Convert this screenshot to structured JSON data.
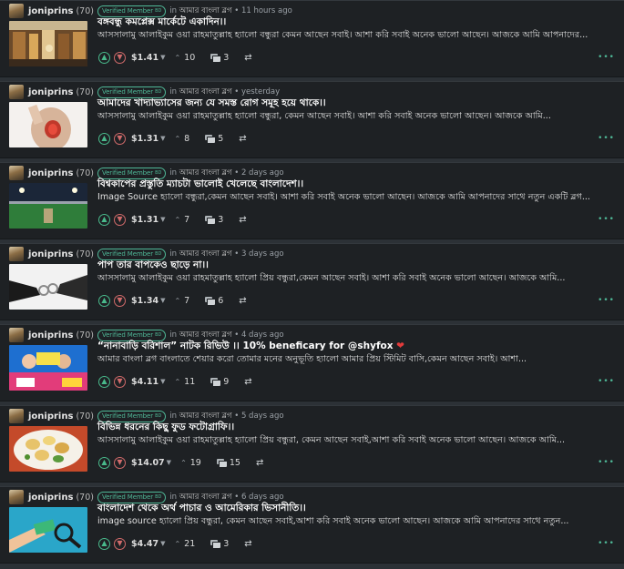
{
  "author": "joniprins",
  "reputation": "(70)",
  "badge": "Verified Member",
  "badge_suffix": "BD",
  "in_word": "in",
  "community": "আমার বাংলা ব্লগ",
  "colors": {
    "accent": "#4fb897",
    "upvote": "#49b98b",
    "downvote": "#d06a6a",
    "card": "#1e2124",
    "page": "#2c3136"
  },
  "icons": {
    "upvote": "chevron-up-circle-icon",
    "downvote": "chevron-down-circle-icon",
    "votes": "chevron-up-icon",
    "comments": "comments-icon",
    "reblog": "reblog-icon",
    "more": "more-dots-icon"
  },
  "posts": [
    {
      "time": "11 hours ago",
      "title": "বঙ্গবন্ধু কমপ্লেক্স মার্কেটে একাদিন।।",
      "excerpt": "আসসালামু আলাইকুম ওয়া রাহমাতুল্লাহ হ্যালো বন্ধুরা কেমন আছেন সবাই। আশা করি সবাই অনেক ভালো আছেন। আজকে আমি আপনাদের...",
      "payout": "$1.41",
      "votes": "10",
      "comments": "3"
    },
    {
      "time": "yesterday",
      "title": "আমাদের খাদ্যাভ্যাসের জন্য যে সমস্ত রোগ সমূহ হয়ে থাকে।।",
      "excerpt": "আসসালামু আলাইকুম ওয়া রাহমাতুল্লাহ হ্যালো বন্ধুরা, কেমন আছেন সবাই। আশা করি সবাই অনেক ভালো আছেন। আজকে আমি...",
      "payout": "$1.31",
      "votes": "8",
      "comments": "5"
    },
    {
      "time": "2 days ago",
      "title": "বিশ্বকাপের প্রস্তুতি ম্যাচটা ভালোই খেলেছে বাংলাদেশ।।",
      "excerpt": "Image Source হ্যালো বন্ধুরা,কেমন আছেন সবাই। আশা করি সবাই অনেক ভালো আছেন। আজকে আমি আপনাদের সাথে নতুন একটি ব্লগ...",
      "payout": "$1.31",
      "votes": "7",
      "comments": "3"
    },
    {
      "time": "3 days ago",
      "title": "পাপ তার বাপকেও ছাড়ে না।।",
      "excerpt": "আসসালামু আলাইকুম ওয়া রাহমাতুল্লাহ হ্যালো প্রিয় বন্ধুরা,কেমন আছেন সবাই। আশা করি সবাই অনেক ভালো আছেন। আজকে আমি...",
      "payout": "$1.34",
      "votes": "7",
      "comments": "6"
    },
    {
      "time": "4 days ago",
      "title": "“নানাবাড়ি বরিশাল” নাটক রিভিউ ।। 10% beneficary for @shyfox",
      "title_emoji": "❤",
      "excerpt": "আমার বাংলা ব্লগ বাংলাতে শেয়ার করো তোমার মনের অনুভূতি হ্যালো আমার প্রিয় স্টিমিট বাসি,কেমন আছেন সবাই। আশা...",
      "payout": "$4.11",
      "votes": "11",
      "comments": "9"
    },
    {
      "time": "5 days ago",
      "title": "বিভিন্ন ধরনের কিছু ফুড ফটোগ্রাফি।।",
      "excerpt": "আসসালামু আলাইকুম ওয়া রাহমাতুল্লাহ হ্যালো প্রিয় বন্ধুরা, কেমন আছেন সবাই,আশা করি সবাই অনেক ভালো আছেন। আজকে আমি...",
      "payout": "$14.07",
      "votes": "19",
      "comments": "15"
    },
    {
      "time": "6 days ago",
      "title": "বাংলাদেশ থেকে অর্থ পাচার ও আমেরিকার ভিসানীতি।।",
      "excerpt": "image source হ্যালো প্রিয় বন্ধুরা, কেমন আছেন সবাই,আশা করি সবাই অনেক ভালো আছেন। আজকে আমি আপনাদের সাথে নতুন...",
      "payout": "$4.47",
      "votes": "21",
      "comments": "3"
    }
  ]
}
